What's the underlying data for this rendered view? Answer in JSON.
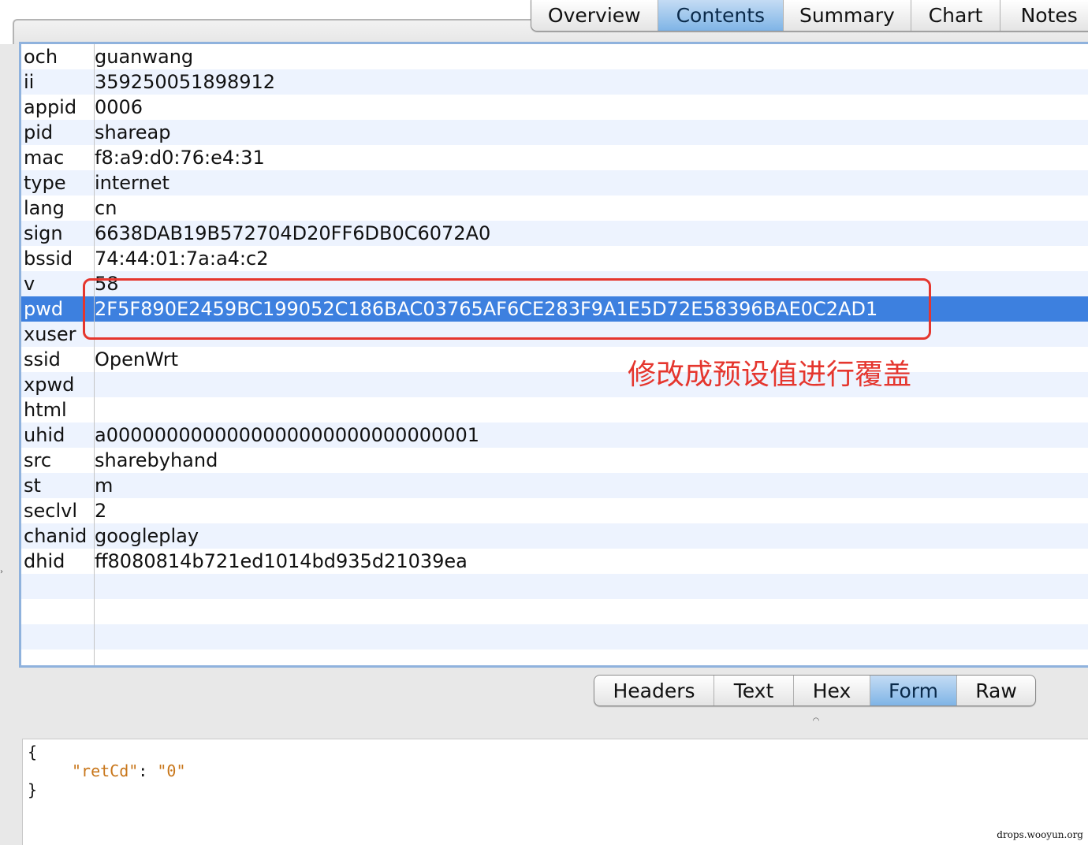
{
  "top_tabs": [
    {
      "label": "Overview",
      "active": false
    },
    {
      "label": "Contents",
      "active": true
    },
    {
      "label": "Summary",
      "active": false
    },
    {
      "label": "Chart",
      "active": false
    },
    {
      "label": "Notes",
      "active": false
    }
  ],
  "form": {
    "rows": [
      {
        "key": "och",
        "value": "guanwang"
      },
      {
        "key": "ii",
        "value": "359250051898912"
      },
      {
        "key": "appid",
        "value": "0006"
      },
      {
        "key": "pid",
        "value": "shareap"
      },
      {
        "key": "mac",
        "value": "f8:a9:d0:76:e4:31"
      },
      {
        "key": "type",
        "value": "internet"
      },
      {
        "key": "lang",
        "value": "cn"
      },
      {
        "key": "sign",
        "value": "6638DAB19B572704D20FF6DB0C6072A0"
      },
      {
        "key": "bssid",
        "value": "74:44:01:7a:a4:c2"
      },
      {
        "key": "v",
        "value": "58"
      },
      {
        "key": "pwd",
        "value": "2F5F890E2459BC199052C186BAC03765AF6CE283F9A1E5D72E58396BAE0C2AD1",
        "selected": true
      },
      {
        "key": "xuser",
        "value": ""
      },
      {
        "key": "ssid",
        "value": "OpenWrt"
      },
      {
        "key": "xpwd",
        "value": ""
      },
      {
        "key": "html",
        "value": ""
      },
      {
        "key": "uhid",
        "value": "a0000000000000000000000000000001"
      },
      {
        "key": "src",
        "value": "sharebyhand"
      },
      {
        "key": "st",
        "value": "m"
      },
      {
        "key": "seclvl",
        "value": "2"
      },
      {
        "key": "chanid",
        "value": "googleplay"
      },
      {
        "key": "dhid",
        "value": "ff8080814b721ed1014bd935d21039ea"
      }
    ],
    "empty_row_count": 4
  },
  "annotation": {
    "text": "修改成预设值进行覆盖",
    "color": "#e5362e"
  },
  "bottom_tabs": [
    {
      "label": "Headers",
      "active": false
    },
    {
      "label": "Text",
      "active": false
    },
    {
      "label": "Hex",
      "active": false
    },
    {
      "label": "Form",
      "active": true
    },
    {
      "label": "Raw",
      "active": false
    }
  ],
  "response": {
    "open_brace": "{",
    "key": "\"retCd\"",
    "colon": ": ",
    "value": "\"0\"",
    "close_brace": "}"
  },
  "watermark": "drops.wooyun.org",
  "colors": {
    "selection": "#3d80df",
    "alt_row": "#edf3fe",
    "json_string": "#c8761a"
  }
}
